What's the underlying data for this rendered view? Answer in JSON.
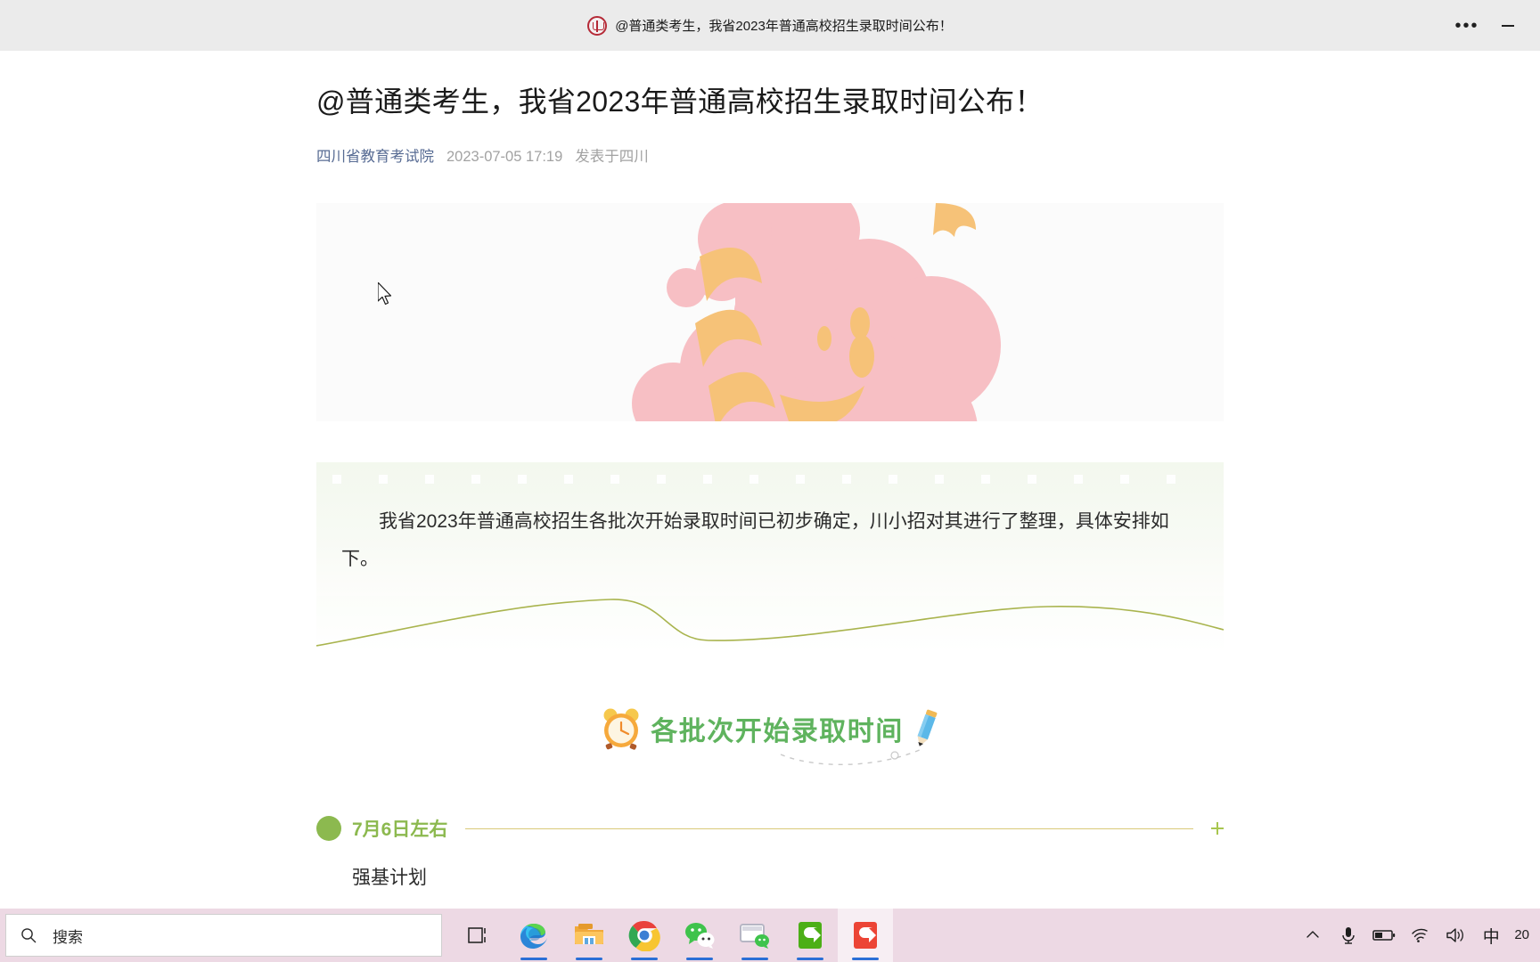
{
  "window": {
    "titlebar_title": "@普通类考生，我省2023年普通高校招生录取时间公布！",
    "logo_name": "site-logo",
    "more_label": "•••",
    "minimize_label": ""
  },
  "article": {
    "title": "@普通类考生，我省2023年普通高校招生录取时间公布！",
    "account": "四川省教育考试院",
    "time": "2023-07-05 17:19",
    "location": "发表于四川",
    "quote": "我省2023年普通高校招生各批次开始录取时间已初步确定，川小招对其进行了整理，具体安排如下。",
    "section_heading": "各批次开始录取时间",
    "timeline": [
      {
        "date": "7月6日左右",
        "body": "强基计划"
      }
    ]
  },
  "taskbar": {
    "search_placeholder": "搜索",
    "apps": [
      {
        "name": "task-view",
        "label": "任务视图"
      },
      {
        "name": "microsoft-edge",
        "label": "Microsoft Edge"
      },
      {
        "name": "file-explorer",
        "label": "文件资源管理器"
      },
      {
        "name": "google-chrome",
        "label": "Google Chrome"
      },
      {
        "name": "wechat",
        "label": "微信"
      },
      {
        "name": "wechat-devtools",
        "label": "微信开发者工具"
      },
      {
        "name": "wps-green",
        "label": "WPS"
      },
      {
        "name": "camtasia-red",
        "label": "Camtasia"
      }
    ],
    "tray": [
      {
        "name": "show-hidden-icons",
        "glyph": "⌃"
      },
      {
        "name": "microphone",
        "glyph": ""
      },
      {
        "name": "battery",
        "glyph": ""
      },
      {
        "name": "wifi",
        "glyph": ""
      },
      {
        "name": "volume",
        "glyph": ""
      },
      {
        "name": "ime-chinese",
        "glyph": "中"
      }
    ],
    "clock": "20"
  },
  "colors": {
    "accent_green": "#5fb35e",
    "timeline_green": "#8cb94f",
    "timeline_line": "#d9c97a",
    "account_link": "#586c94",
    "taskbar_bg": "#edd9e4",
    "titlebar_bg": "#ebebeb",
    "hero_pink": "#f7bfc4",
    "hero_orange": "#f6c278"
  }
}
